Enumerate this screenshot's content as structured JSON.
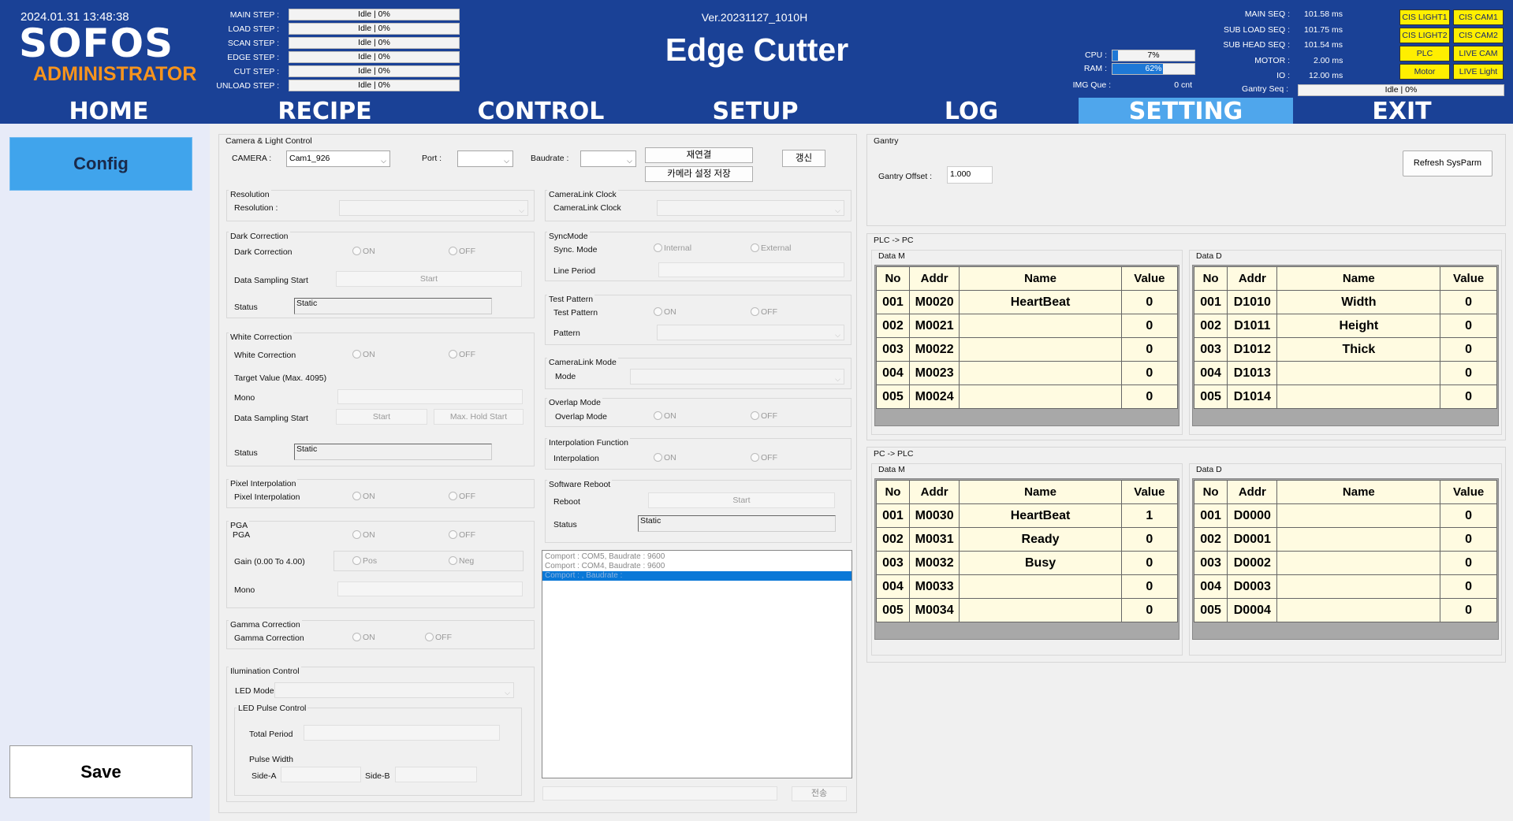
{
  "header": {
    "datetime": "2024.01.31 13:48:38",
    "logo": "SOFOS",
    "role": "ADMINISTRATOR",
    "version": "Ver.20231127_1010H",
    "app_title": "Edge Cutter",
    "steps": [
      {
        "label": "MAIN STEP :",
        "value": "Idle | 0%"
      },
      {
        "label": "LOAD STEP :",
        "value": "Idle | 0%"
      },
      {
        "label": "SCAN STEP :",
        "value": "Idle | 0%"
      },
      {
        "label": "EDGE STEP :",
        "value": "Idle | 0%"
      },
      {
        "label": "CUT STEP :",
        "value": "Idle | 0%"
      },
      {
        "label": "UNLOAD STEP :",
        "value": "Idle | 0%"
      }
    ],
    "cpu": {
      "label": "CPU :",
      "value": "7%",
      "fraction": 0.07
    },
    "ram": {
      "label": "RAM :",
      "value": "62%",
      "fraction": 0.62
    },
    "img_que": {
      "label": "IMG Que :",
      "value": "0 cnt"
    },
    "seqs": [
      {
        "label": "MAIN SEQ :",
        "value": "101.58 ms"
      },
      {
        "label": "SUB LOAD SEQ :",
        "value": "101.75 ms"
      },
      {
        "label": "SUB HEAD SEQ :",
        "value": "101.54 ms"
      },
      {
        "label": "MOTOR :",
        "value": "2.00 ms"
      },
      {
        "label": "IO :",
        "value": "12.00 ms"
      }
    ],
    "gantry_seq": {
      "label": "Gantry Seq :",
      "value": "Idle | 0%"
    },
    "status_buttons": [
      "CIS LIGHT1",
      "CIS CAM1",
      "CIS LIGHT2",
      "CIS CAM2",
      "PLC",
      "LIVE CAM",
      "Motor",
      "LIVE Light"
    ],
    "status_color": "#ffef00"
  },
  "nav": {
    "tabs": [
      "HOME",
      "RECIPE",
      "CONTROL",
      "SETUP",
      "LOG",
      "SETTING",
      "EXIT"
    ],
    "active": "SETTING",
    "accent": "#4fa6ec",
    "bg": "#1a4196"
  },
  "sidebar": {
    "config_label": "Config",
    "save_label": "Save",
    "config_color": "#40a4ec"
  },
  "camera": {
    "group_title": "Camera & Light Control",
    "camera_label": "CAMERA :",
    "camera_value": "Cam1_926",
    "port_label": "Port :",
    "port_value": "",
    "baudrate_label": "Baudrate :",
    "baudrate_value": "",
    "reconnect_label": "재연결",
    "save_cam_label": "카메라 설정 저장",
    "refresh_label": "갱신",
    "resolution": {
      "title": "Resolution",
      "label": "Resolution :"
    },
    "dark": {
      "title": "Dark Correction",
      "label": "Dark Correction",
      "on": "ON",
      "off": "OFF",
      "sampling_label": "Data Sampling Start",
      "start": "Start",
      "status_label": "Status",
      "status_value": "Static"
    },
    "white": {
      "title": "White Correction",
      "label": "White Correction",
      "on": "ON",
      "off": "OFF",
      "target_label": "Target Value (Max. 4095)",
      "mono_label": "Mono",
      "sampling_label": "Data Sampling Start",
      "start": "Start",
      "maxhold": "Max. Hold Start",
      "status_label": "Status",
      "status_value": "Static"
    },
    "pixel": {
      "title": "Pixel Interpolation",
      "label": "Pixel Interpolation",
      "on": "ON",
      "off": "OFF"
    },
    "pga": {
      "title": "PGA",
      "label": "PGA",
      "on": "ON",
      "off": "OFF",
      "gain_label": "Gain (0.00 To 4.00)",
      "pos": "Pos",
      "neg": "Neg",
      "mono_label": "Mono"
    },
    "gamma": {
      "title": "Gamma Correction",
      "label": "Gamma Correction",
      "on": "ON",
      "off": "OFF"
    },
    "illum": {
      "title": "Ilumination Control",
      "led_mode_label": "LED Mode",
      "pulse_title": "LED Pulse Control",
      "total_label": "Total Period",
      "pulse_width_label": "Pulse Width",
      "side_a": "Side-A",
      "side_b": "Side-B"
    },
    "clock": {
      "title": "CameraLink Clock",
      "label": "CameraLink Clock"
    },
    "sync": {
      "title": "SyncMode",
      "label": "Sync. Mode",
      "internal": "Internal",
      "external": "External",
      "line_period": "Line Period"
    },
    "test": {
      "title": "Test Pattern",
      "label": "Test Pattern",
      "on": "ON",
      "off": "OFF",
      "pattern_label": "Pattern"
    },
    "clmode": {
      "title": "CameraLink Mode",
      "label": "Mode"
    },
    "overlap": {
      "title": "Overlap Mode",
      "label": "Overlap Mode",
      "on": "ON",
      "off": "OFF"
    },
    "interp": {
      "title": "Interpolation Function",
      "label": "Interpolation",
      "on": "ON",
      "off": "OFF"
    },
    "reboot": {
      "title": "Software Reboot",
      "label": "Reboot",
      "start": "Start",
      "status_label": "Status",
      "status_value": "Static"
    },
    "comports": [
      "Comport : COM5, Baudrate : 9600",
      "Comport : COM4, Baudrate : 9600",
      "Comport : , Baudrate :"
    ],
    "send_label": "전송"
  },
  "gantry": {
    "title": "Gantry",
    "offset_label": "Gantry Offset :",
    "offset_value": "1.000",
    "refresh_label": "Refresh SysParm"
  },
  "plc_to_pc": {
    "title": "PLC -> PC",
    "data_m": {
      "title": "Data M",
      "headers": [
        "No",
        "Addr",
        "Name",
        "Value"
      ],
      "rows": [
        [
          "001",
          "M0020",
          "HeartBeat",
          "0"
        ],
        [
          "002",
          "M0021",
          "",
          "0"
        ],
        [
          "003",
          "M0022",
          "",
          "0"
        ],
        [
          "004",
          "M0023",
          "",
          "0"
        ],
        [
          "005",
          "M0024",
          "",
          "0"
        ]
      ]
    },
    "data_d": {
      "title": "Data D",
      "headers": [
        "No",
        "Addr",
        "Name",
        "Value"
      ],
      "rows": [
        [
          "001",
          "D1010",
          "Width",
          "0"
        ],
        [
          "002",
          "D1011",
          "Height",
          "0"
        ],
        [
          "003",
          "D1012",
          "Thick",
          "0"
        ],
        [
          "004",
          "D1013",
          "",
          "0"
        ],
        [
          "005",
          "D1014",
          "",
          "0"
        ]
      ]
    }
  },
  "pc_to_plc": {
    "title": "PC -> PLC",
    "data_m": {
      "title": "Data M",
      "headers": [
        "No",
        "Addr",
        "Name",
        "Value"
      ],
      "rows": [
        [
          "001",
          "M0030",
          "HeartBeat",
          "1"
        ],
        [
          "002",
          "M0031",
          "Ready",
          "0"
        ],
        [
          "003",
          "M0032",
          "Busy",
          "0"
        ],
        [
          "004",
          "M0033",
          "",
          "0"
        ],
        [
          "005",
          "M0034",
          "",
          "0"
        ]
      ]
    },
    "data_d": {
      "title": "Data D",
      "headers": [
        "No",
        "Addr",
        "Name",
        "Value"
      ],
      "rows": [
        [
          "001",
          "D0000",
          "",
          "0"
        ],
        [
          "002",
          "D0001",
          "",
          "0"
        ],
        [
          "003",
          "D0002",
          "",
          "0"
        ],
        [
          "004",
          "D0003",
          "",
          "0"
        ],
        [
          "005",
          "D0004",
          "",
          "0"
        ]
      ]
    }
  }
}
